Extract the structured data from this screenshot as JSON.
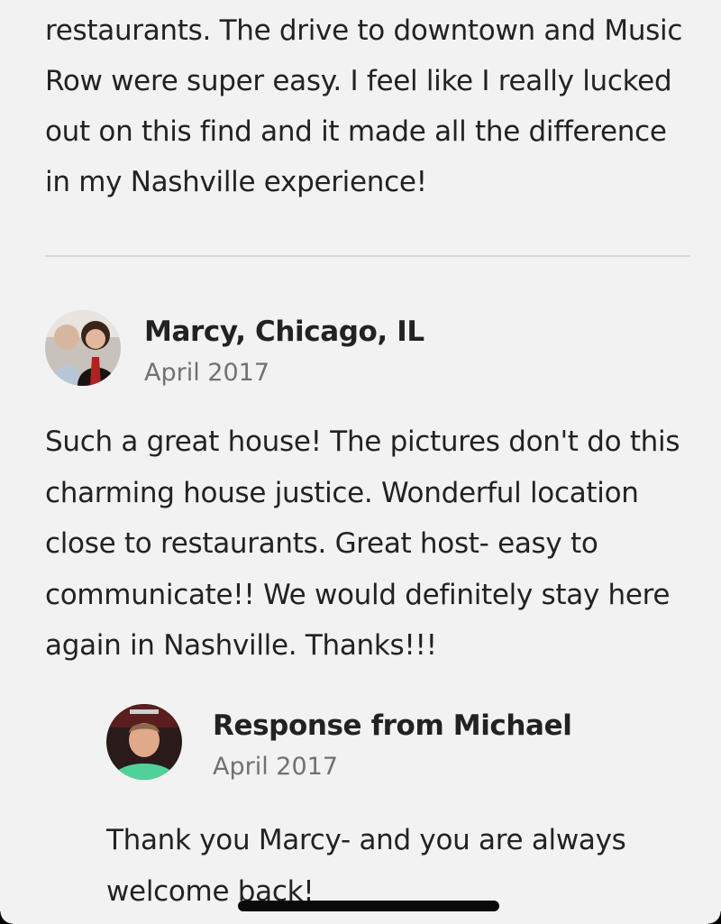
{
  "previous_review": {
    "text": "restaurants. The drive to downtown and Music Row were super easy. I feel like I really lucked out on this find and it made all the difference in my Nashville experience!"
  },
  "review": {
    "reviewer": "Marcy, Chicago, IL",
    "date": "April 2017",
    "avatar_icon": "reviewer-photo",
    "text": "Such a great house! The pictures don't do this charming house justice. Wonderful location close to restaurants. Great host- easy to communicate!! We would definitely stay here again in Nashville. Thanks!!!"
  },
  "response": {
    "title": "Response from Michael",
    "date": "April 2017",
    "avatar_icon": "host-photo",
    "text": "Thank you Marcy- and you are always welcome back!"
  },
  "colors": {
    "background": "#f2f2f2",
    "text": "#222222",
    "muted": "#717171",
    "divider": "#d9d9d9"
  }
}
